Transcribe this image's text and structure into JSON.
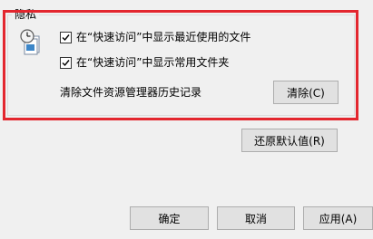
{
  "privacy": {
    "title": "隐私",
    "show_recent_files": {
      "label": "在“快速访问”中显示最近使用的文件",
      "checked": true
    },
    "show_frequent_folders": {
      "label": "在“快速访问”中显示常用文件夹",
      "checked": true
    },
    "clear_history_label": "清除文件资源管理器历史记录",
    "clear_button": "清除(C)"
  },
  "restore_defaults_button": "还原默认值(R)",
  "footer": {
    "ok_button": "确定",
    "cancel_button": "取消",
    "apply_button": "应用(A)"
  },
  "colors": {
    "highlight": "#e3262e",
    "window_bg": "#f0f0f0",
    "button_bg": "#e1e1e1",
    "button_border": "#adadad"
  },
  "icons": {
    "privacy": "clock-document-icon",
    "check": "checkmark-icon"
  }
}
